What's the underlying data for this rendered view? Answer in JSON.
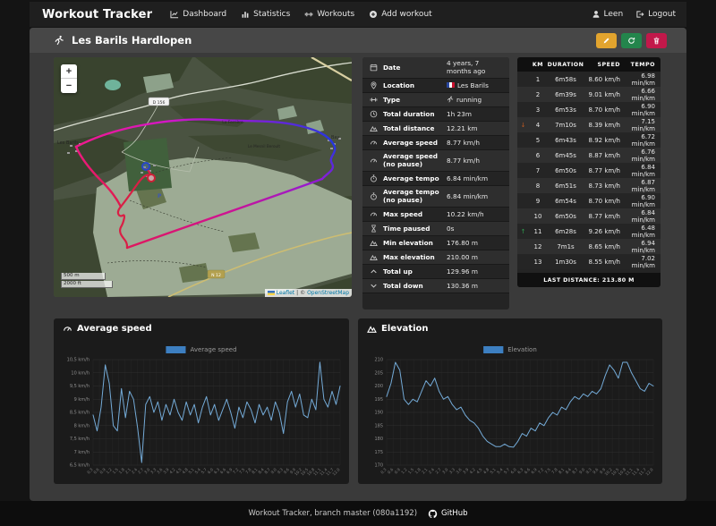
{
  "navbar": {
    "brand": "Workout Tracker",
    "items": [
      {
        "label": "Dashboard",
        "icon": "dashboard-icon"
      },
      {
        "label": "Statistics",
        "icon": "statistics-icon"
      },
      {
        "label": "Workouts",
        "icon": "workouts-icon"
      },
      {
        "label": "Add workout",
        "icon": "add-workout-icon"
      }
    ],
    "user": "Leen",
    "logout": "Logout"
  },
  "header": {
    "title": "Les Barils Hardlopen"
  },
  "details": {
    "rows": [
      {
        "icon": "calendar-icon",
        "label": "Date",
        "value": "4 years, 7 months ago",
        "prefix": ""
      },
      {
        "icon": "location-icon",
        "label": "Location",
        "value": "Les Barils",
        "prefix": "flag-fr"
      },
      {
        "icon": "dumbbell-icon",
        "label": "Type",
        "value": "running",
        "prefix": "runner"
      },
      {
        "icon": "clock-icon",
        "label": "Total duration",
        "value": "1h 23m",
        "prefix": ""
      },
      {
        "icon": "mountain-icon",
        "label": "Total distance",
        "value": "12.21 km",
        "prefix": ""
      },
      {
        "icon": "gauge-icon",
        "label": "Average speed",
        "value": "8.77 km/h",
        "prefix": ""
      },
      {
        "icon": "gauge-icon",
        "label": "Average speed (no pause)",
        "value": "8.77 km/h",
        "prefix": ""
      },
      {
        "icon": "stopwatch-icon",
        "label": "Average tempo",
        "value": "6.84 min/km",
        "prefix": ""
      },
      {
        "icon": "stopwatch-icon",
        "label": "Average tempo (no pause)",
        "value": "6.84 min/km",
        "prefix": ""
      },
      {
        "icon": "gauge-icon",
        "label": "Max speed",
        "value": "10.22 km/h",
        "prefix": ""
      },
      {
        "icon": "hourglass-icon",
        "label": "Time paused",
        "value": "0s",
        "prefix": ""
      },
      {
        "icon": "mountain-icon",
        "label": "Min elevation",
        "value": "176.80 m",
        "prefix": ""
      },
      {
        "icon": "mountain-icon",
        "label": "Max elevation",
        "value": "210.00 m",
        "prefix": ""
      },
      {
        "icon": "chevron-up-icon",
        "label": "Total up",
        "value": "129.96 m",
        "prefix": ""
      },
      {
        "icon": "chevron-down-icon",
        "label": "Total down",
        "value": "130.36 m",
        "prefix": ""
      }
    ]
  },
  "splits": {
    "columns": [
      "KM",
      "DURATION",
      "SPEED",
      "TEMPO"
    ],
    "rows": [
      {
        "km": "1",
        "duration": "6m58s",
        "speed": "8.60 km/h",
        "tempo": "6.98 min/km",
        "trend": ""
      },
      {
        "km": "2",
        "duration": "6m39s",
        "speed": "9.01 km/h",
        "tempo": "6.66 min/km",
        "trend": ""
      },
      {
        "km": "3",
        "duration": "6m53s",
        "speed": "8.70 km/h",
        "tempo": "6.90 min/km",
        "trend": ""
      },
      {
        "km": "4",
        "duration": "7m10s",
        "speed": "8.39 km/h",
        "tempo": "7.15 min/km",
        "trend": "down"
      },
      {
        "km": "5",
        "duration": "6m43s",
        "speed": "8.92 km/h",
        "tempo": "6.72 min/km",
        "trend": ""
      },
      {
        "km": "6",
        "duration": "6m45s",
        "speed": "8.87 km/h",
        "tempo": "6.76 min/km",
        "trend": ""
      },
      {
        "km": "7",
        "duration": "6m50s",
        "speed": "8.77 km/h",
        "tempo": "6.84 min/km",
        "trend": ""
      },
      {
        "km": "8",
        "duration": "6m51s",
        "speed": "8.73 km/h",
        "tempo": "6.87 min/km",
        "trend": ""
      },
      {
        "km": "9",
        "duration": "6m54s",
        "speed": "8.70 km/h",
        "tempo": "6.90 min/km",
        "trend": ""
      },
      {
        "km": "10",
        "duration": "6m50s",
        "speed": "8.77 km/h",
        "tempo": "6.84 min/km",
        "trend": ""
      },
      {
        "km": "11",
        "duration": "6m28s",
        "speed": "9.26 km/h",
        "tempo": "6.48 min/km",
        "trend": "up"
      },
      {
        "km": "12",
        "duration": "7m1s",
        "speed": "8.65 km/h",
        "tempo": "6.94 min/km",
        "trend": ""
      },
      {
        "km": "13",
        "duration": "1m30s",
        "speed": "8.55 km/h",
        "tempo": "7.02 min/km",
        "trend": ""
      }
    ],
    "footer": "LAST DISTANCE: 213.80 M"
  },
  "map": {
    "zoom_in": "+",
    "zoom_out": "−",
    "scale_m": "500 m",
    "scale_ft": "2000 ft",
    "attribution_leaflet": "Leaflet",
    "attribution_sep": " | © ",
    "attribution_osm": "OpenStreetMap",
    "road_shields": [
      "D 156",
      "N 12"
    ],
    "labels": {
      "les_barils": "Les Barils",
      "bay": "Bay",
      "la_ferriere": "La Ferrière",
      "le_mesnil": "Le Mesnil Beroult",
      "parking": "P"
    },
    "route_colors": {
      "start": "#2637de",
      "mid": "#d416c6",
      "end": "#d91f45"
    }
  },
  "footer": {
    "text": "Workout Tracker, branch master (080a1192)",
    "github": "GitHub"
  },
  "chart_data": [
    {
      "type": "line",
      "title": "Average speed",
      "legend": [
        "Average speed"
      ],
      "legend_color": "#3d7fc1",
      "line_color": "#74abd8",
      "ylabel": "km/h",
      "ylim": [
        6.5,
        10.5
      ],
      "yticks": [
        "10,5 km/h",
        "10 km/h",
        "9,5 km/h",
        "9 km/h",
        "8,5 km/h",
        "8 km/h",
        "7,5 km/h",
        "7 km/h",
        "6,5 km/h"
      ],
      "xlabels": [
        "0.3",
        "0.6",
        "0.9",
        "1.2",
        "1.5",
        "1.8",
        "2.1",
        "2.4",
        "2.7",
        "3.0",
        "3.3",
        "3.6",
        "3.9",
        "4.2",
        "4.5",
        "4.8",
        "5.1",
        "5.4",
        "5.7",
        "6.0",
        "6.3",
        "6.6",
        "6.9",
        "7.2",
        "7.5",
        "7.8",
        "8.1",
        "8.4",
        "8.7",
        "9.0",
        "9.3",
        "9.6",
        "9.9",
        "10.2",
        "10.5",
        "10.8",
        "11.1",
        "11.4",
        "11.7",
        "12.0"
      ],
      "values": [
        8.4,
        7.8,
        8.7,
        10.3,
        9.6,
        8.0,
        7.8,
        9.4,
        8.3,
        9.3,
        9.0,
        7.9,
        6.6,
        8.8,
        9.1,
        8.5,
        8.9,
        8.2,
        8.8,
        8.4,
        9.0,
        8.5,
        8.2,
        8.9,
        8.4,
        8.8,
        8.1,
        8.7,
        9.1,
        8.4,
        8.8,
        8.2,
        8.6,
        9.0,
        8.5,
        7.9,
        8.7,
        8.3,
        8.9,
        8.6,
        8.1,
        8.8,
        8.4,
        8.7,
        8.2,
        8.9,
        8.5,
        7.7,
        8.9,
        9.3,
        8.7,
        9.2,
        8.4,
        8.3,
        9.0,
        8.6,
        10.4,
        9.0,
        8.7,
        9.3,
        8.8,
        9.5
      ]
    },
    {
      "type": "line",
      "title": "Elevation",
      "legend": [
        "Elevation"
      ],
      "legend_color": "#3d7fc1",
      "line_color": "#74abd8",
      "ylabel": "m",
      "ylim": [
        170,
        210
      ],
      "yticks": [
        "210",
        "205",
        "200",
        "195",
        "190",
        "185",
        "180",
        "175",
        "170"
      ],
      "xlabels": [
        "0.3",
        "0.6",
        "0.9",
        "1.2",
        "1.5",
        "1.8",
        "2.1",
        "2.4",
        "2.7",
        "3.0",
        "3.3",
        "3.6",
        "3.9",
        "4.2",
        "4.5",
        "4.8",
        "5.1",
        "5.4",
        "5.7",
        "6.0",
        "6.3",
        "6.6",
        "6.9",
        "7.2",
        "7.5",
        "7.8",
        "8.1",
        "8.4",
        "8.7",
        "9.0",
        "9.3",
        "9.6",
        "9.9",
        "10.2",
        "10.5",
        "10.8",
        "11.1",
        "11.4",
        "11.7",
        "12.0"
      ],
      "values": [
        196,
        201,
        209,
        206,
        195,
        193,
        195,
        194,
        198,
        202,
        200,
        203,
        198,
        195,
        196,
        193,
        191,
        192,
        189,
        187,
        186,
        184,
        181,
        179,
        178,
        177,
        177,
        178,
        177,
        176.8,
        179,
        182,
        181,
        184,
        183,
        186,
        185,
        188,
        190,
        189,
        192,
        191,
        194,
        196,
        195,
        197,
        196,
        198,
        197,
        199,
        204,
        208,
        206,
        203,
        209,
        209,
        205,
        202,
        199,
        198,
        201,
        200
      ]
    }
  ]
}
